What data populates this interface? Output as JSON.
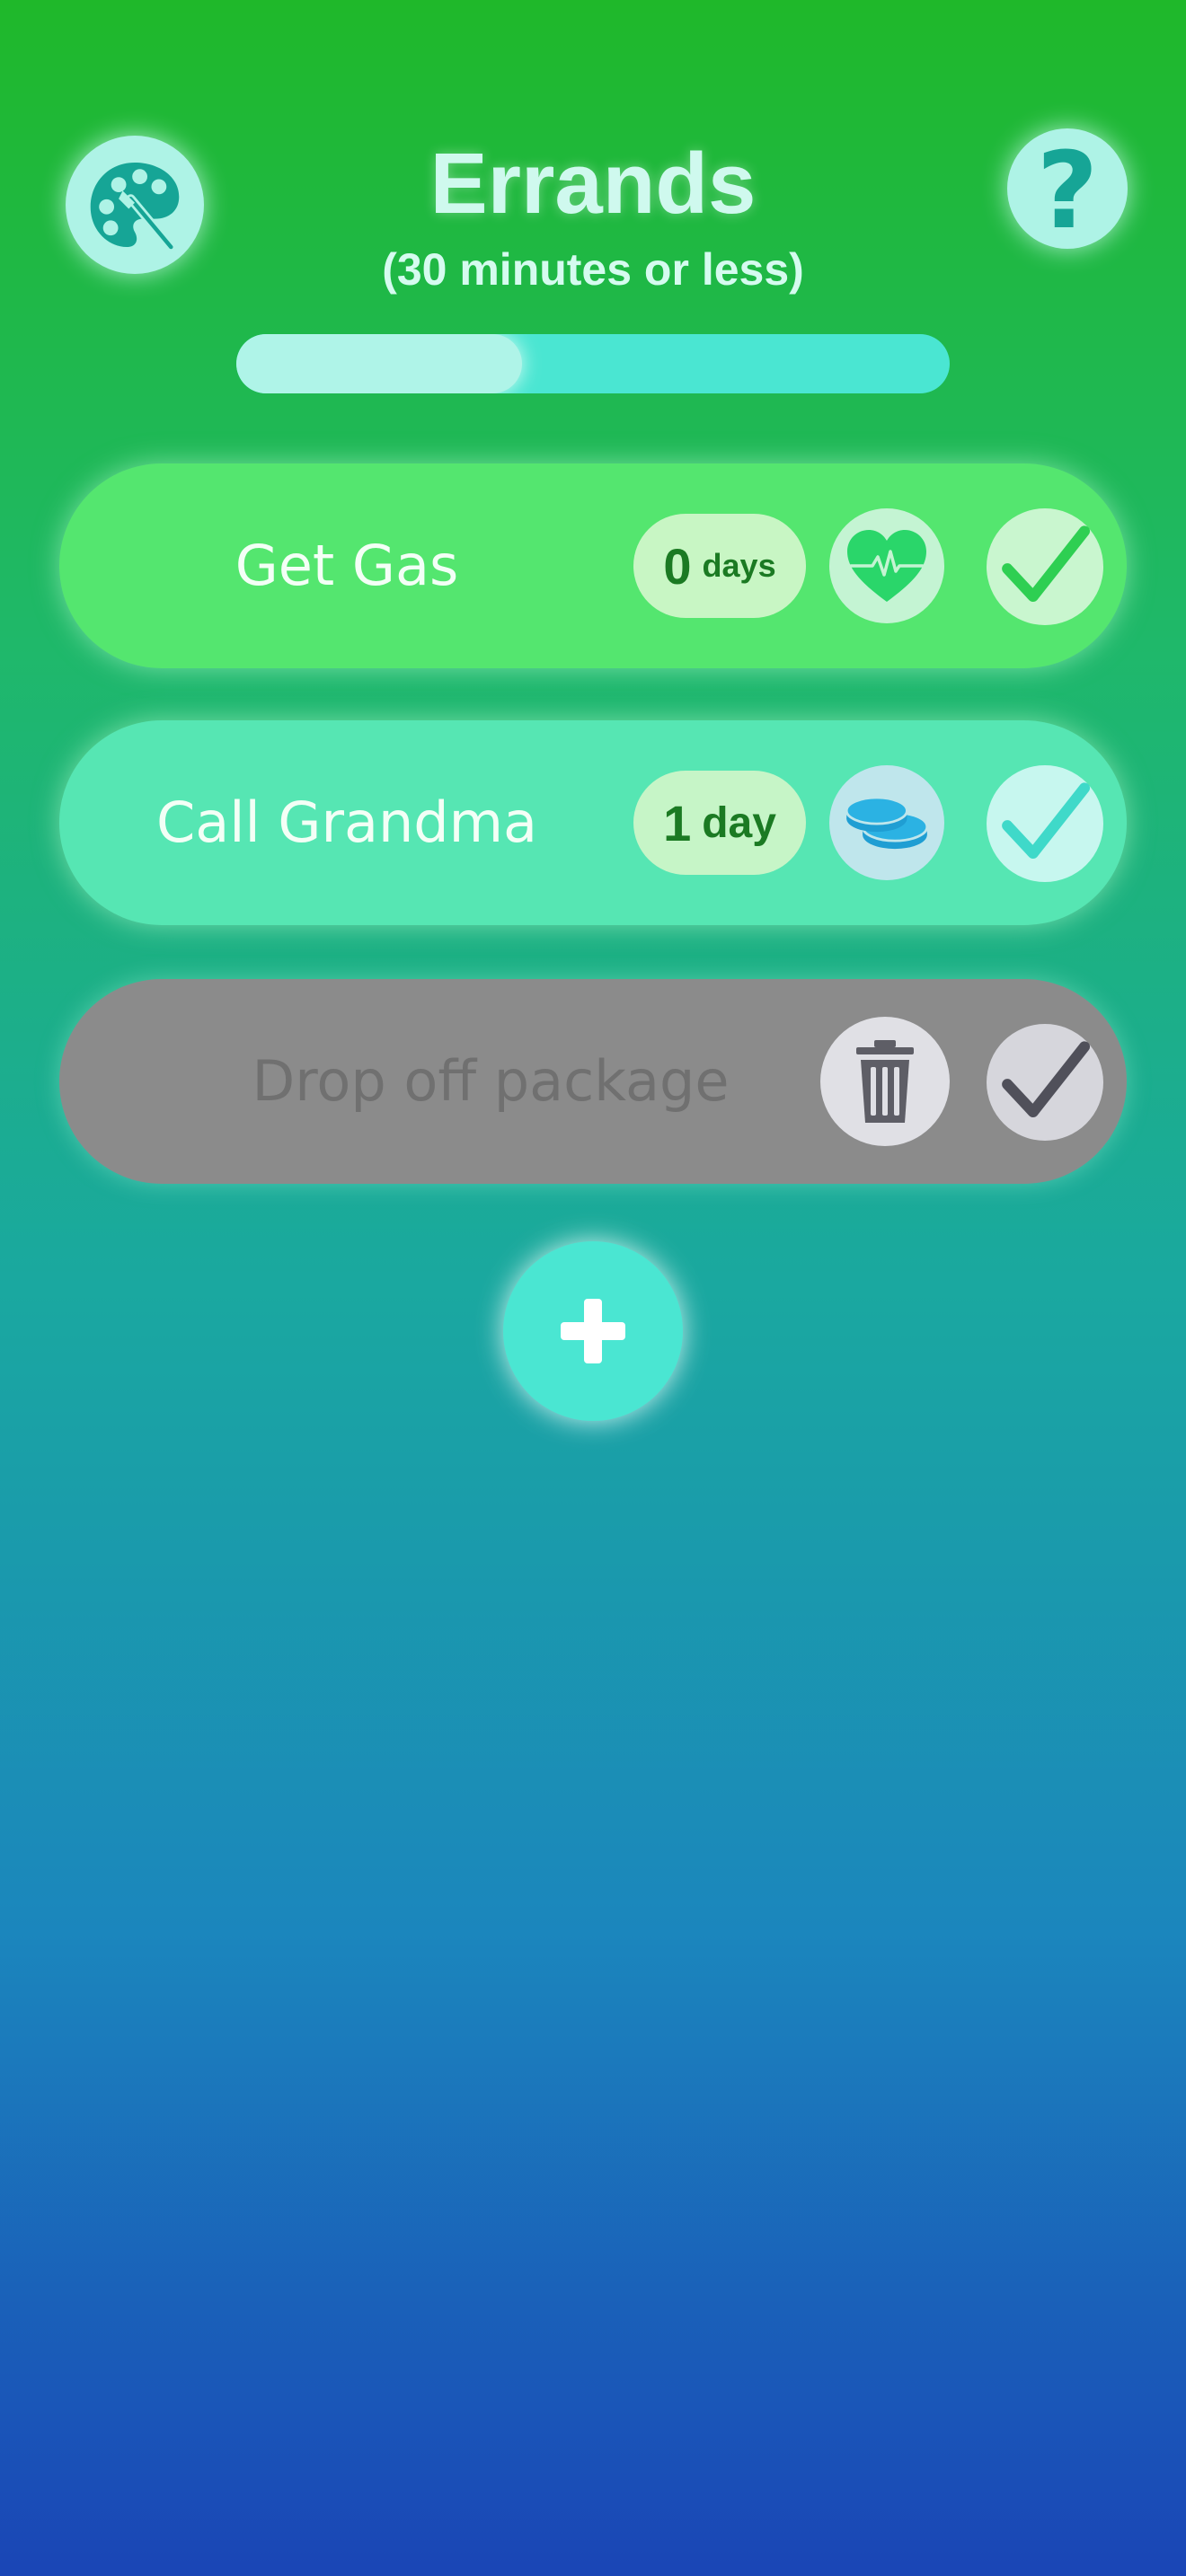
{
  "header": {
    "title": "Errands",
    "subtitle": "(30 minutes or less)",
    "progress": 0.4,
    "palette_icon": "palette-icon",
    "help_icon": "question-mark-icon",
    "help_label": "?"
  },
  "tasks": [
    {
      "label": "Get Gas",
      "streak_number": "0",
      "streak_unit": "days",
      "category_icon": "heart-pulse-icon",
      "check_icon": "checkmark-icon",
      "color": "#54e66f"
    },
    {
      "label": "Call Grandma",
      "streak_number": "1",
      "streak_unit": "day",
      "category_icon": "coins-icon",
      "check_icon": "checkmark-icon",
      "color": "#56e6b3"
    },
    {
      "label": "Drop off package",
      "state": "completed",
      "action_icon": "trash-icon",
      "check_icon": "checkmark-icon",
      "color": "#8b8b8b"
    }
  ],
  "add_button": {
    "icon": "plus-icon"
  },
  "colors": {
    "accent": "#4ae6d2",
    "light_accent": "#aef3e6",
    "streak_text": "#1b7a23",
    "icon_teal": "#16a596"
  }
}
